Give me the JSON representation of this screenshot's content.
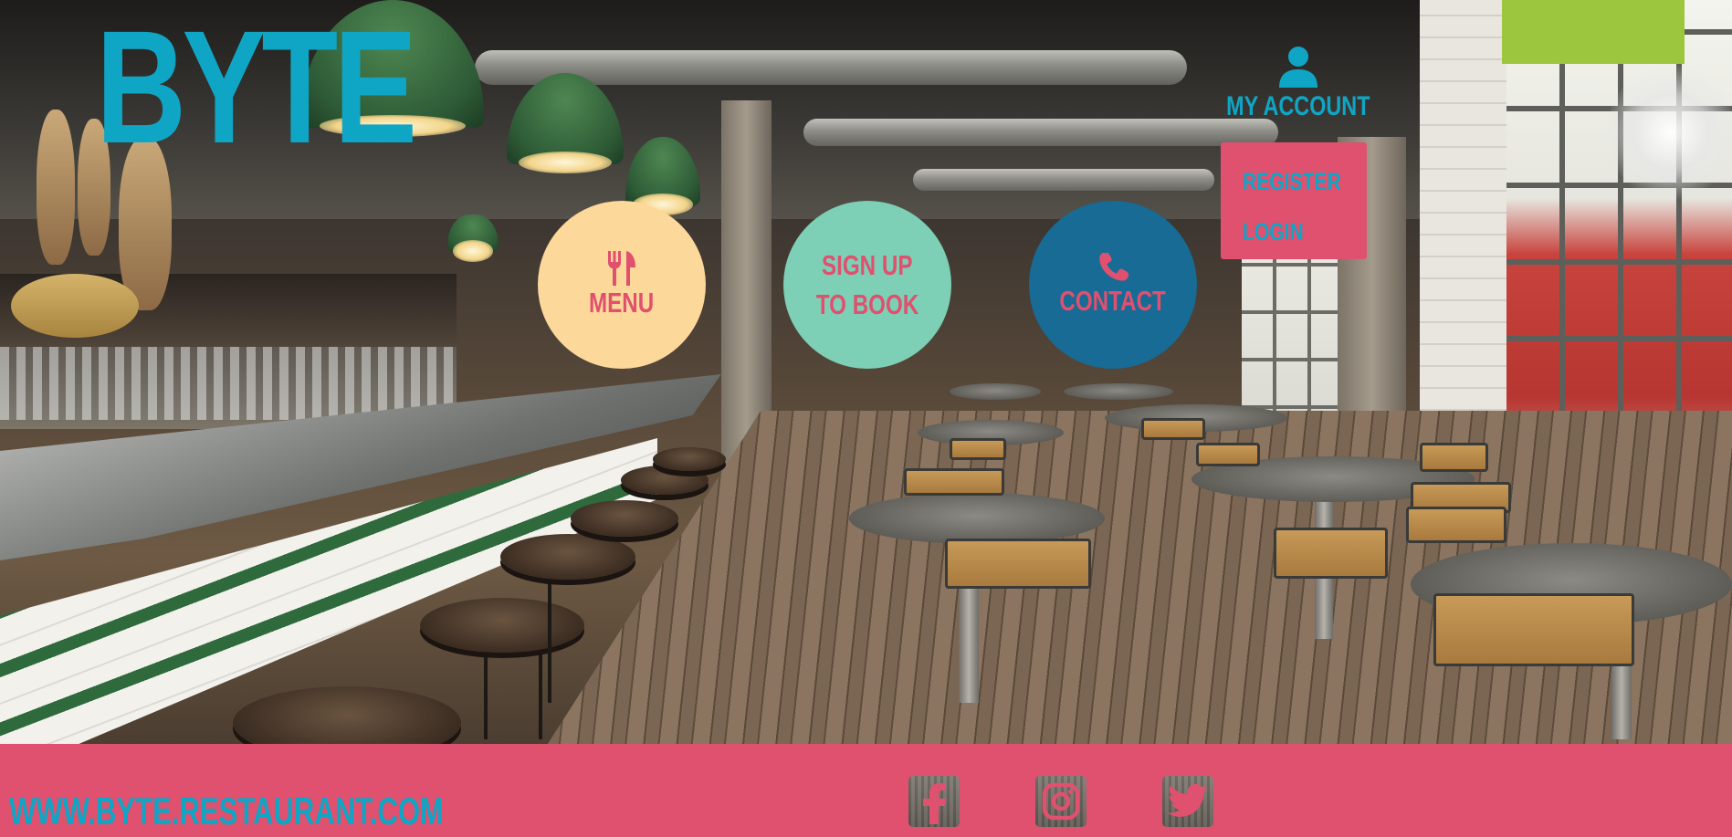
{
  "brand": {
    "logo_text": "BYTE",
    "color_primary": "#0fa6c6",
    "color_accent": "#e0506f"
  },
  "nav": {
    "menu": {
      "label": "MENU",
      "icon": "cutlery-icon",
      "color": "#fcd89b"
    },
    "signup": {
      "line1": "SIGN UP",
      "line2": "TO BOOK",
      "color": "#7dd0b5"
    },
    "contact": {
      "label": "CONTACT",
      "icon": "phone-icon",
      "color": "#176b94"
    }
  },
  "account": {
    "label": "MY ACCOUNT",
    "icon": "user-icon",
    "menu_items": [
      {
        "label": "REGISTER"
      },
      {
        "label": "LOGIN"
      }
    ]
  },
  "footer": {
    "url": "WWW.BYTE.RESTAURANT.COM",
    "social": [
      {
        "icon": "facebook-icon"
      },
      {
        "icon": "instagram-icon"
      },
      {
        "icon": "twitter-icon"
      }
    ]
  }
}
